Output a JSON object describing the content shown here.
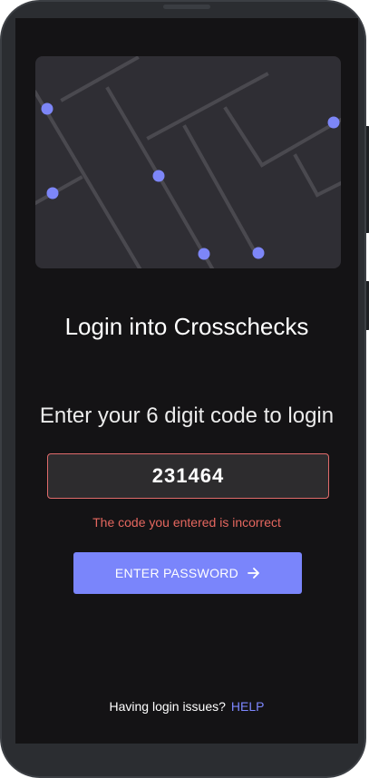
{
  "login": {
    "title": "Login into Crosschecks",
    "subtitle": "Enter your 6 digit code to login",
    "code_value": "231464",
    "error_message": "The code you entered is incorrect",
    "submit_label": "ENTER PASSWORD",
    "help_prompt": "Having login issues?",
    "help_link": "HELP"
  },
  "colors": {
    "background": "#141315",
    "accent": "#7a85fb",
    "error": "#e5675f",
    "illustration_bg": "#2f2e34",
    "illustration_dot": "#7d86f7"
  },
  "icons": {
    "submit": "arrow-right-icon"
  }
}
